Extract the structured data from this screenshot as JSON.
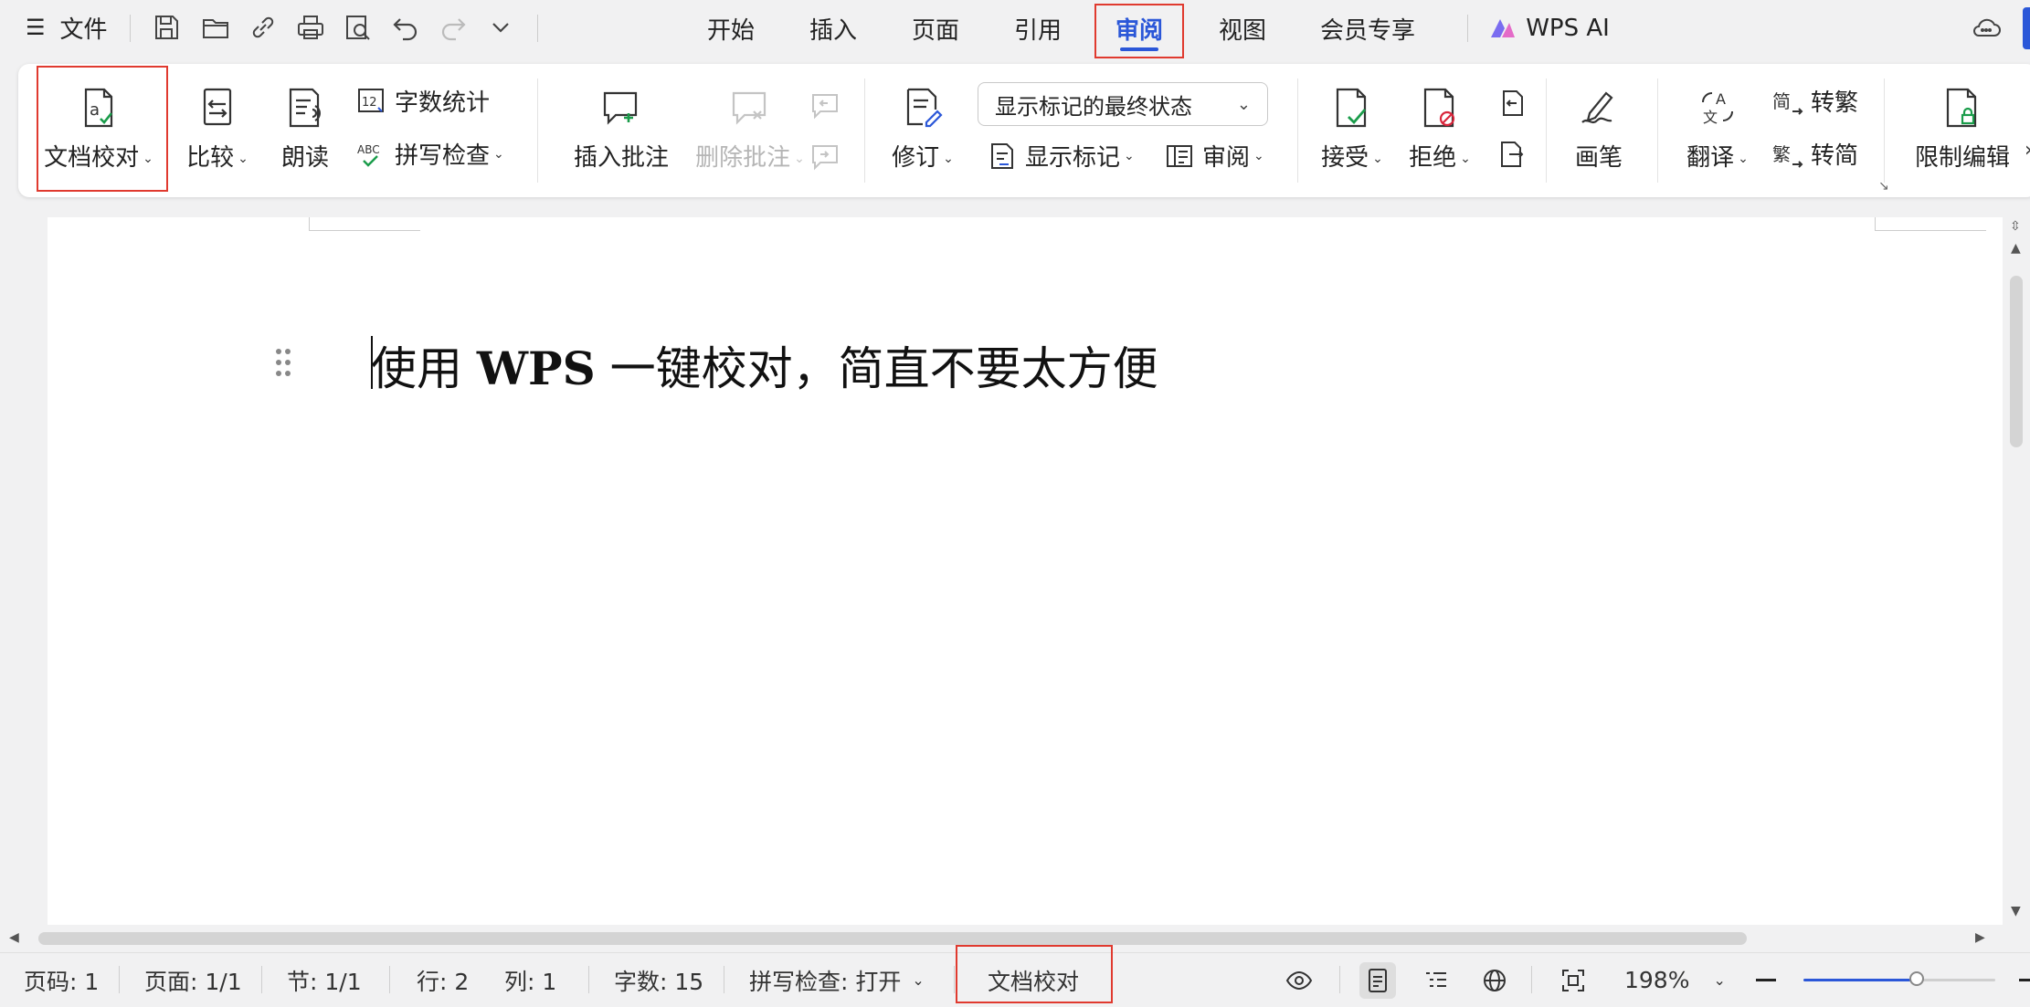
{
  "topbar": {
    "menu_label": "文件",
    "tabs": [
      "开始",
      "插入",
      "页面",
      "引用",
      "审阅",
      "视图",
      "会员专享"
    ],
    "active_tab": "审阅",
    "ai_label": "WPS AI"
  },
  "ribbon": {
    "proofread": "文档校对",
    "compare": "比较",
    "read_aloud": "朗读",
    "word_count": "字数统计",
    "spell_check": "拼写检查",
    "insert_comment": "插入批注",
    "delete_comment": "删除批注",
    "track_changes": "修订",
    "markup_state": "显示标记的最终状态",
    "show_markup": "显示标记",
    "review_pane": "审阅",
    "accept": "接受",
    "reject": "拒绝",
    "pen": "画笔",
    "translate": "翻译",
    "to_traditional": "转繁",
    "to_simplified": "转简",
    "restrict_edit": "限制编辑"
  },
  "document": {
    "text_part1": "使用 ",
    "text_bold": "WPS",
    "text_part2": " 一键校对，简直不要太方便"
  },
  "status": {
    "page_num": "页码: 1",
    "pages": "页面: 1/1",
    "section": "节: 1/1",
    "line": "行: 2",
    "column": "列: 1",
    "word_count": "字数: 15",
    "spell_check": "拼写检查: 打开",
    "proofread": "文档校对",
    "zoom": "198%"
  },
  "colors": {
    "accent": "#2b57d8",
    "highlight_box": "#e03a2f",
    "check_green": "#1a9c4a",
    "reject_red": "#d9253b"
  }
}
